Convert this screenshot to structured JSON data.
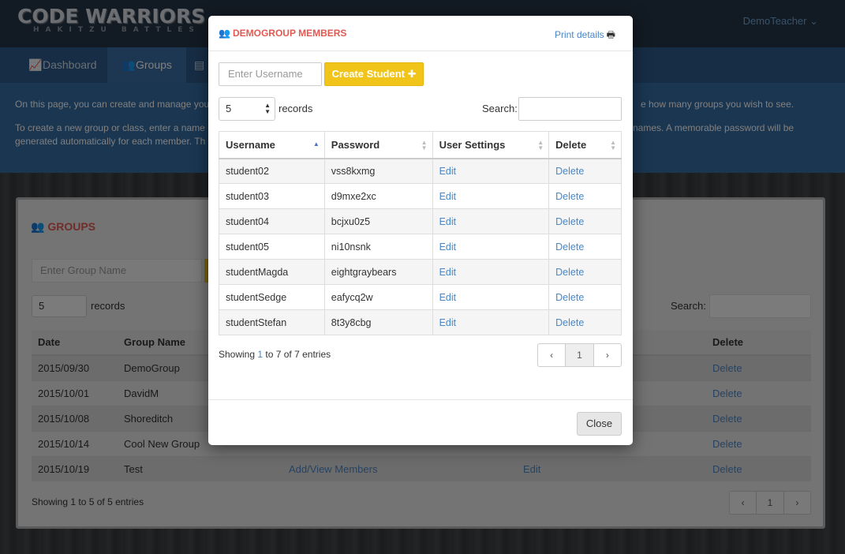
{
  "app": {
    "logo_title": "CODE WARRIORS",
    "logo_subtitle": "HAKITZU BATTLES",
    "user_menu": "DemoTeacher ⌄"
  },
  "nav": {
    "tabs": [
      {
        "label": "Dashboard",
        "icon": "line-chart-icon"
      },
      {
        "label": "Groups",
        "icon": "users-icon",
        "active": true
      },
      {
        "label": "",
        "icon": "file-icon"
      }
    ]
  },
  "intro": {
    "line1_left": "On this page, you can create and manage you",
    "line1_right": "e how many groups you wish to see.",
    "line2_left": "To create a new group or class, enter a name",
    "line2_right": "names. A memorable password will be",
    "line3_left": "generated automatically for each member. Th"
  },
  "groups_panel": {
    "title": "GROUPS",
    "group_name_placeholder": "Enter Group Name",
    "records_value": "5",
    "records_label": "records",
    "search_label": "Search:",
    "columns": [
      "Date",
      "Group Name",
      "",
      "",
      "Delete"
    ],
    "rows": [
      {
        "date": "2015/09/30",
        "name": "DemoGroup",
        "members": "",
        "edit": "",
        "delete": "Delete"
      },
      {
        "date": "2015/10/01",
        "name": "DavidM",
        "members": "",
        "edit": "",
        "delete": "Delete"
      },
      {
        "date": "2015/10/08",
        "name": "Shoreditch",
        "members": "",
        "edit": "",
        "delete": "Delete"
      },
      {
        "date": "2015/10/14",
        "name": "Cool New Group",
        "members": "",
        "edit": "",
        "delete": "Delete"
      },
      {
        "date": "2015/10/19",
        "name": "Test",
        "members": "Add/View Members",
        "edit": "Edit",
        "delete": "Delete"
      }
    ],
    "info": "Showing 1 to 5 of 5 entries",
    "pager": {
      "prev": "‹",
      "page": "1",
      "next": "›"
    }
  },
  "modal": {
    "title": "DEMOGROUP MEMBERS",
    "print_label": "Print details",
    "username_placeholder": "Enter Username",
    "create_label": "Create Student ✚",
    "records_value": "5",
    "records_label": "records",
    "search_label": "Search:",
    "columns": {
      "username": "Username",
      "password": "Password",
      "settings": "User Settings",
      "delete": "Delete"
    },
    "rows": [
      {
        "username": "student02",
        "password": "vss8kxmg",
        "edit": "Edit",
        "delete": "Delete"
      },
      {
        "username": "student03",
        "password": "d9mxe2xc",
        "edit": "Edit",
        "delete": "Delete"
      },
      {
        "username": "student04",
        "password": "bcjxu0z5",
        "edit": "Edit",
        "delete": "Delete"
      },
      {
        "username": "student05",
        "password": "ni10nsnk",
        "edit": "Edit",
        "delete": "Delete"
      },
      {
        "username": "studentMagda",
        "password": "eightgraybears",
        "edit": "Edit",
        "delete": "Delete"
      },
      {
        "username": "studentSedge",
        "password": "eafycq2w",
        "edit": "Edit",
        "delete": "Delete"
      },
      {
        "username": "studentStefan",
        "password": "8t3y8cbg",
        "edit": "Edit",
        "delete": "Delete"
      }
    ],
    "info_prefix": "Showing ",
    "info_start": "1",
    "info_suffix": " to 7 of 7 entries",
    "pager": {
      "prev": "‹",
      "page": "1",
      "next": "›"
    },
    "close_label": "Close"
  },
  "colors": {
    "accent_red": "#e05a52",
    "accent_yellow": "#f0c419",
    "link_blue": "#4a86c5",
    "nav_blue": "#2f5b8a"
  }
}
